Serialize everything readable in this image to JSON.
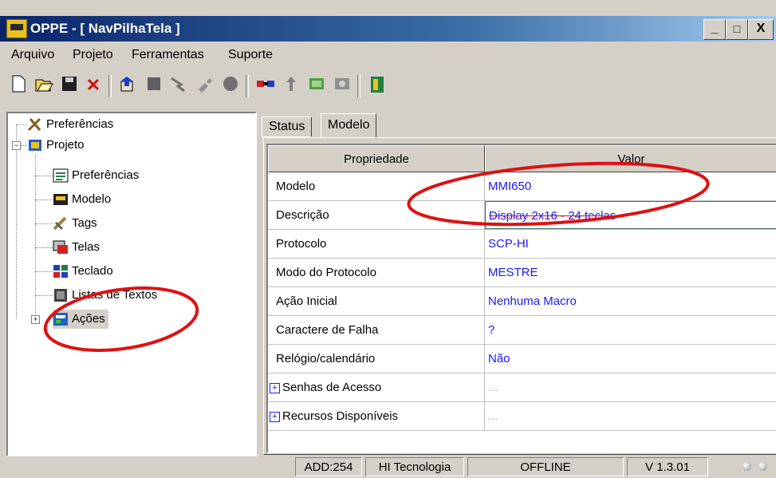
{
  "window": {
    "title": "OPPE - [ NavPilhaTela ]",
    "controls": [
      "_",
      "□",
      "X"
    ]
  },
  "menu": [
    "Arquivo",
    "Projeto",
    "Ferramentas",
    "Suporte"
  ],
  "toolbar": {
    "icons": [
      "new-file-icon",
      "open-folder-icon",
      "save-icon",
      "delete-icon",
      "transfer-icon",
      "stop-icon",
      "tool-icon",
      "plug-icon",
      "record-icon",
      "connect-icon",
      "upload-icon",
      "download-icon",
      "settings-icon",
      "exit-icon"
    ]
  },
  "tree": {
    "root_preferences": "Preferências",
    "project": "Projeto",
    "children": [
      "Preferências",
      "Modelo",
      "Tags",
      "Telas",
      "Teclado",
      "Listas de Textos",
      "Ações"
    ]
  },
  "tabs": [
    "Status",
    "Modelo"
  ],
  "grid": {
    "headers": [
      "Propriedade",
      "Valor"
    ],
    "rows": [
      {
        "prop": "Modelo",
        "value": "MMI650"
      },
      {
        "prop": "Descrição",
        "value": "Display 2x16 - 24 teclas"
      },
      {
        "prop": "Protocolo",
        "value": "SCP-HI"
      },
      {
        "prop": "Modo do Protocolo",
        "value": "MESTRE"
      },
      {
        "prop": "Ação Inicial",
        "value": "Nenhuma Macro"
      },
      {
        "prop": "Caractere de Falha",
        "value": "?"
      },
      {
        "prop": "Relógio/calendário",
        "value": "Não"
      },
      {
        "prop": "Senhas de Acesso",
        "value": "..."
      },
      {
        "prop": "Recursos Disponíveis",
        "value": "..."
      }
    ]
  },
  "statusbar": {
    "addr": "ADD:254",
    "company": "HI Tecnologia",
    "connection": "OFFLINE",
    "version": "V 1.3.01"
  },
  "colors": {
    "title_bg": "#0a246a",
    "value_text": "#1a1aff",
    "highlight_circle": "#e01010",
    "face": "#d4d0c8"
  }
}
